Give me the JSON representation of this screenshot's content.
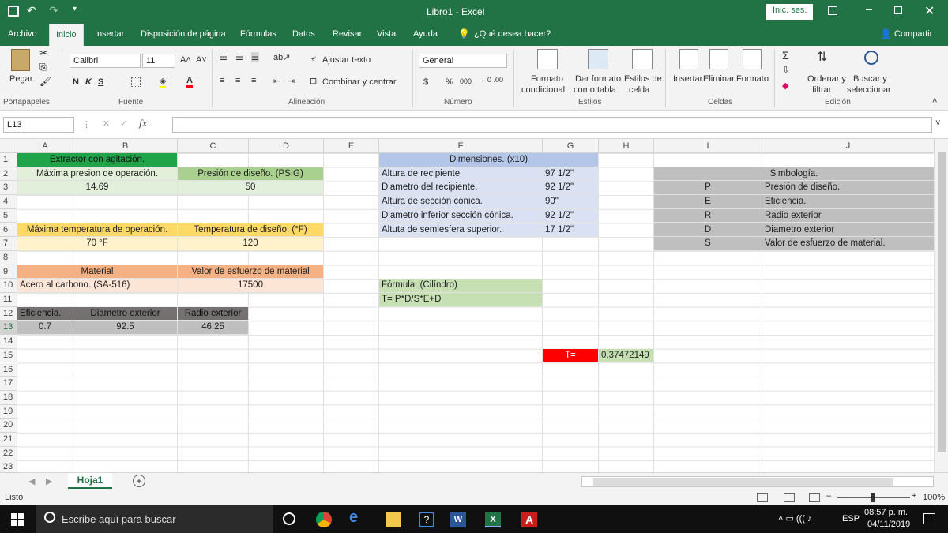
{
  "window": {
    "title": "Libro1  -  Excel",
    "signin": "Inic. ses."
  },
  "tabs": [
    "Archivo",
    "Inicio",
    "Insertar",
    "Disposición de página",
    "Fórmulas",
    "Datos",
    "Revisar",
    "Vista",
    "Ayuda",
    "¿Qué desea hacer?"
  ],
  "share": "Compartir",
  "ribbon": {
    "paste": "Pegar",
    "font_name": "Calibri",
    "font_size": "11",
    "bold": "N",
    "italic": "K",
    "underline": "S",
    "wrap_text": "Ajustar texto",
    "merge_center": "Combinar y centrar",
    "number_format": "General",
    "currency": "$",
    "percent": "%",
    "thousands": "000",
    "cond_format": [
      "Formato",
      "condicional"
    ],
    "format_table": [
      "Dar formato",
      "como tabla"
    ],
    "cell_styles": [
      "Estilos de",
      "celda"
    ],
    "insert": "Insertar",
    "delete": "Eliminar",
    "format": "Formato",
    "sort_filter": [
      "Ordenar y",
      "filtrar"
    ],
    "find_select": [
      "Buscar y",
      "seleccionar"
    ],
    "groups": [
      "Portapapeles",
      "Fuente",
      "Alineación",
      "Número",
      "Estilos",
      "Celdas",
      "Edición"
    ]
  },
  "formula_bar": {
    "name_box": "L13",
    "fx": "fx",
    "formula": ""
  },
  "columns": [
    "A",
    "B",
    "C",
    "D",
    "E",
    "F",
    "G",
    "H",
    "I",
    "J"
  ],
  "rows": [
    "1",
    "2",
    "3",
    "4",
    "5",
    "6",
    "7",
    "8",
    "9",
    "10",
    "11",
    "12",
    "13",
    "14",
    "15",
    "16",
    "17",
    "18",
    "19",
    "20",
    "21",
    "22",
    "23"
  ],
  "cells": {
    "A1": "Extractor con agitación.",
    "A2": "Máxima presion de operación.",
    "C2": "Presión de diseño. (PSIG)",
    "A3": "14.69",
    "C3": "50",
    "A6": "Máxima temperatura de operación.",
    "C6": "Temperatura de diseño. (°F)",
    "A7": "70 °F",
    "C7": "120",
    "A9": "Material",
    "C9": "Valor de esfuerzo de material",
    "A10": "Acero al carbono. (SA-516)",
    "C10": "17500",
    "A12": "Eficiencia.",
    "B12": "Diametro exterior",
    "C12": "Radio exterior",
    "A13": "0.7",
    "B13": "92.5",
    "C13": "46.25",
    "F1": "Dimensiones. (x10)",
    "F2": "Altura de recipiente",
    "G2": "97 1/2\"",
    "F3": "Diametro del recipiente.",
    "G3": "92 1/2\"",
    "F4": "Altura de sección cónica.",
    "G4": "90\"",
    "F5": "Diametro inferior sección cónica.",
    "G5": "92 1/2\"",
    "F6": "Altuta de semiesfera superior.",
    "G6": "17 1/2\"",
    "F10": "Fórmula. (Cilíndro)",
    "F11": "T= P*D/S*E+D",
    "G15": "T=",
    "H15": "0.37472149",
    "I2": "Simbología.",
    "I3": "P",
    "J3": "Presión de diseño.",
    "I4": "E",
    "J4": "Eficiencia.",
    "I5": "R",
    "J5": "Radio exterior",
    "I6": "D",
    "J6": "Diametro exterior",
    "I7": "S",
    "J7": "Valor de esfuerzo de material."
  },
  "sheet_tab": "Hoja1",
  "status": {
    "ready": "Listo",
    "zoom": "100%"
  },
  "taskbar": {
    "search": "Escribe aquí para buscar",
    "lang": "ESP",
    "time": "08:57 p. m.",
    "date": "04/11/2019"
  },
  "colors": {
    "excel_green": "#217346",
    "header_green": "#21a34a",
    "red": "#ff0000"
  }
}
